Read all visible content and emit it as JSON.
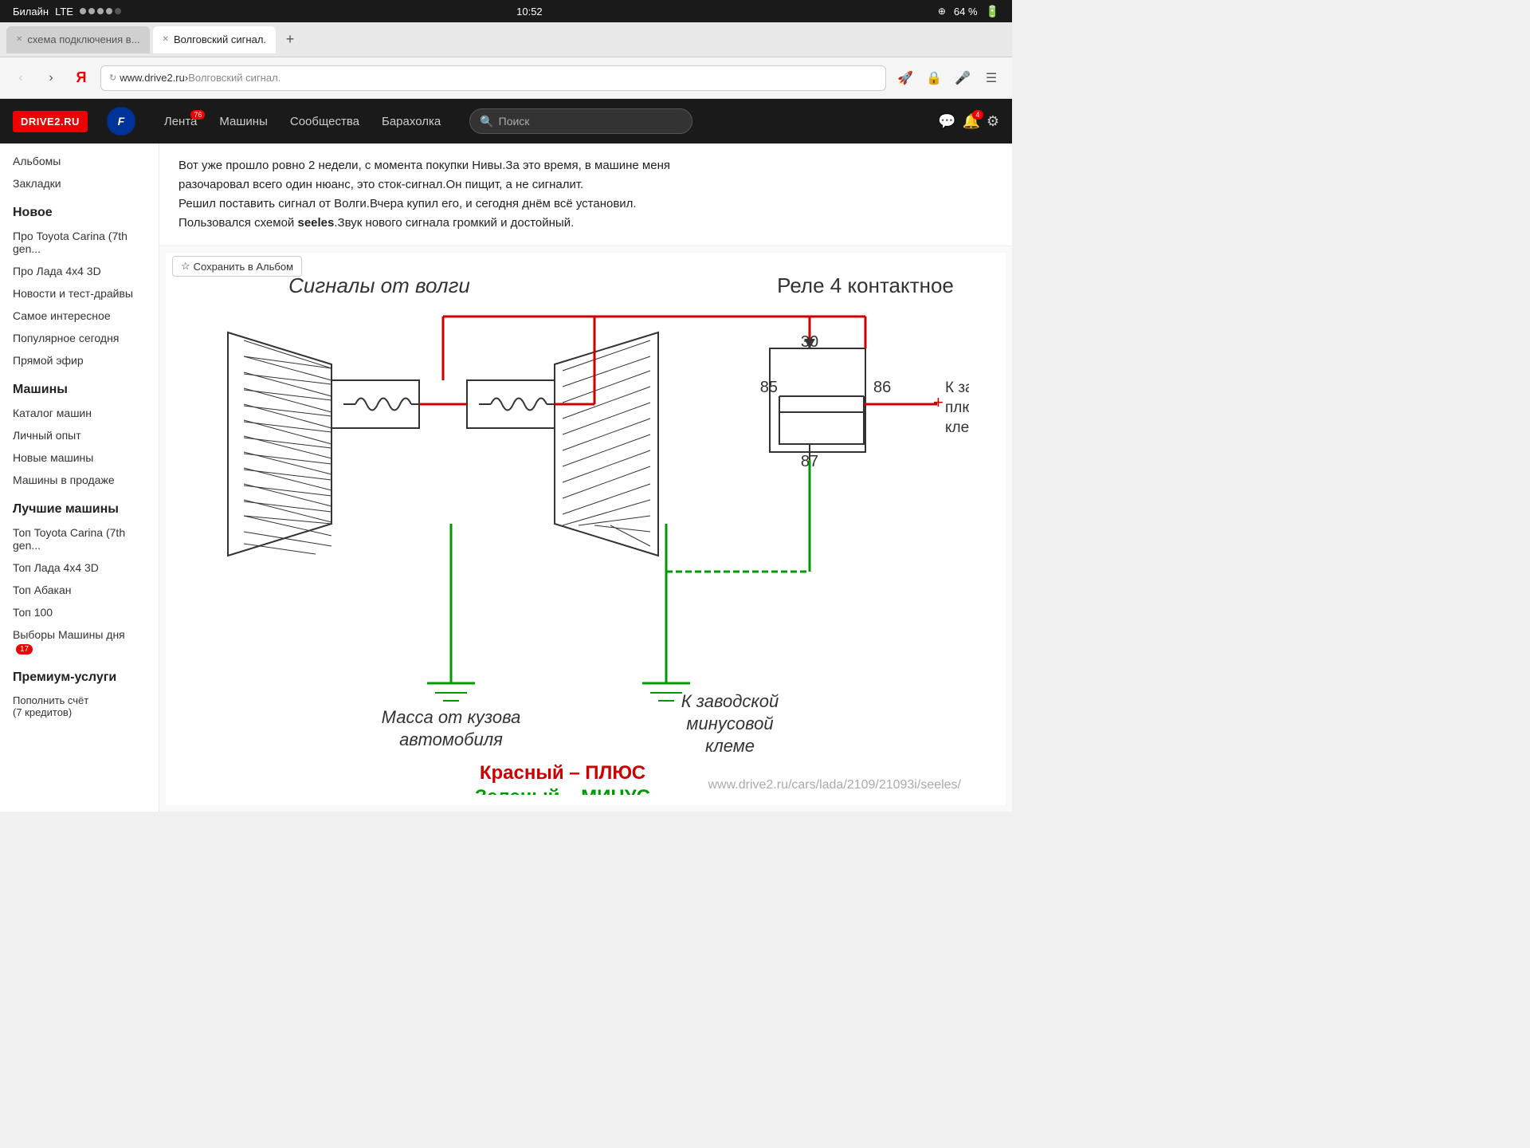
{
  "status_bar": {
    "carrier": "Билайн",
    "network": "LTE",
    "time": "10:52",
    "battery": "64 %"
  },
  "tabs": [
    {
      "id": "tab1",
      "label": "схема подключения в...",
      "active": false
    },
    {
      "id": "tab2",
      "label": "Волговский сигнал.",
      "active": true
    }
  ],
  "tab_new_label": "+",
  "address_bar": {
    "domain": "www.drive2.ru",
    "separator": " › ",
    "path": "Волговский сигнал."
  },
  "site_header": {
    "logo": "DRIVE2.RU",
    "ford_label": "F",
    "nav": [
      {
        "label": "Лента",
        "badge": "76"
      },
      {
        "label": "Машины",
        "badge": ""
      },
      {
        "label": "Сообщества",
        "badge": ""
      },
      {
        "label": "Барахолка",
        "badge": ""
      }
    ],
    "search_placeholder": "Поиск",
    "notifications_badge": "4"
  },
  "sidebar": {
    "top_links": [
      {
        "label": "Альбомы"
      },
      {
        "label": "Закладки"
      }
    ],
    "sections": [
      {
        "title": "Новое",
        "items": [
          {
            "label": "Про Toyota Carina (7th gen..."
          },
          {
            "label": "Про Лада 4x4 3D"
          },
          {
            "label": "Новости и тест-драйвы"
          },
          {
            "label": "Самое интересное"
          },
          {
            "label": "Популярное сегодня"
          },
          {
            "label": "Прямой эфир"
          }
        ]
      },
      {
        "title": "Машины",
        "items": [
          {
            "label": "Каталог машин"
          },
          {
            "label": "Личный опыт"
          },
          {
            "label": "Новые машины"
          },
          {
            "label": "Машины в продаже"
          }
        ]
      },
      {
        "title": "Лучшие машины",
        "items": [
          {
            "label": "Топ Toyota Carina (7th gen..."
          },
          {
            "label": "Топ Лада 4x4 3D"
          },
          {
            "label": "Топ Абакан"
          },
          {
            "label": "Топ 100"
          },
          {
            "label": "Выборы Машины дня",
            "badge": "17"
          }
        ]
      },
      {
        "title": "Премиум-услуги",
        "items": [
          {
            "label": "Пополнить счёт\n(7 кредитов)"
          }
        ]
      }
    ]
  },
  "article": {
    "text_line1": "Вот уже прошло ровно 2 недели, с момента покупки Нивы.За это время, в машине меня",
    "text_line2": "разочаровал всего один нюанс, это сток-сигнал.Он пищит, а не сигналит.",
    "text_line3": "Решил поставить сигнал от Волги.Вчера купил его, и сегодня днём всё установил.",
    "text_line4_prefix": "Пользовался схемой ",
    "text_line4_bold": "seeles",
    "text_line4_suffix": ".Звук нового сигнала громкий и достойный."
  },
  "save_album_btn": "Сохранить в Альбом",
  "diagram": {
    "title_signals": "Сигналы от волги",
    "title_relay": "Реле 4 контактное",
    "label_30": "30",
    "label_85": "85",
    "label_86": "86",
    "label_87": "87",
    "label_mass": "Масса от кузова\nавтомобиля",
    "label_plus_terminal": "К заводской\nплюсовой\nклеме",
    "label_minus_terminal": "К заводской\nминусовой\nклеме",
    "label_red": "Красный – ПЛЮС",
    "label_green": "Зеленый – МИНУС",
    "watermark": "www.drive2.ru/cars/lada/2109/21093i/seeles/"
  }
}
